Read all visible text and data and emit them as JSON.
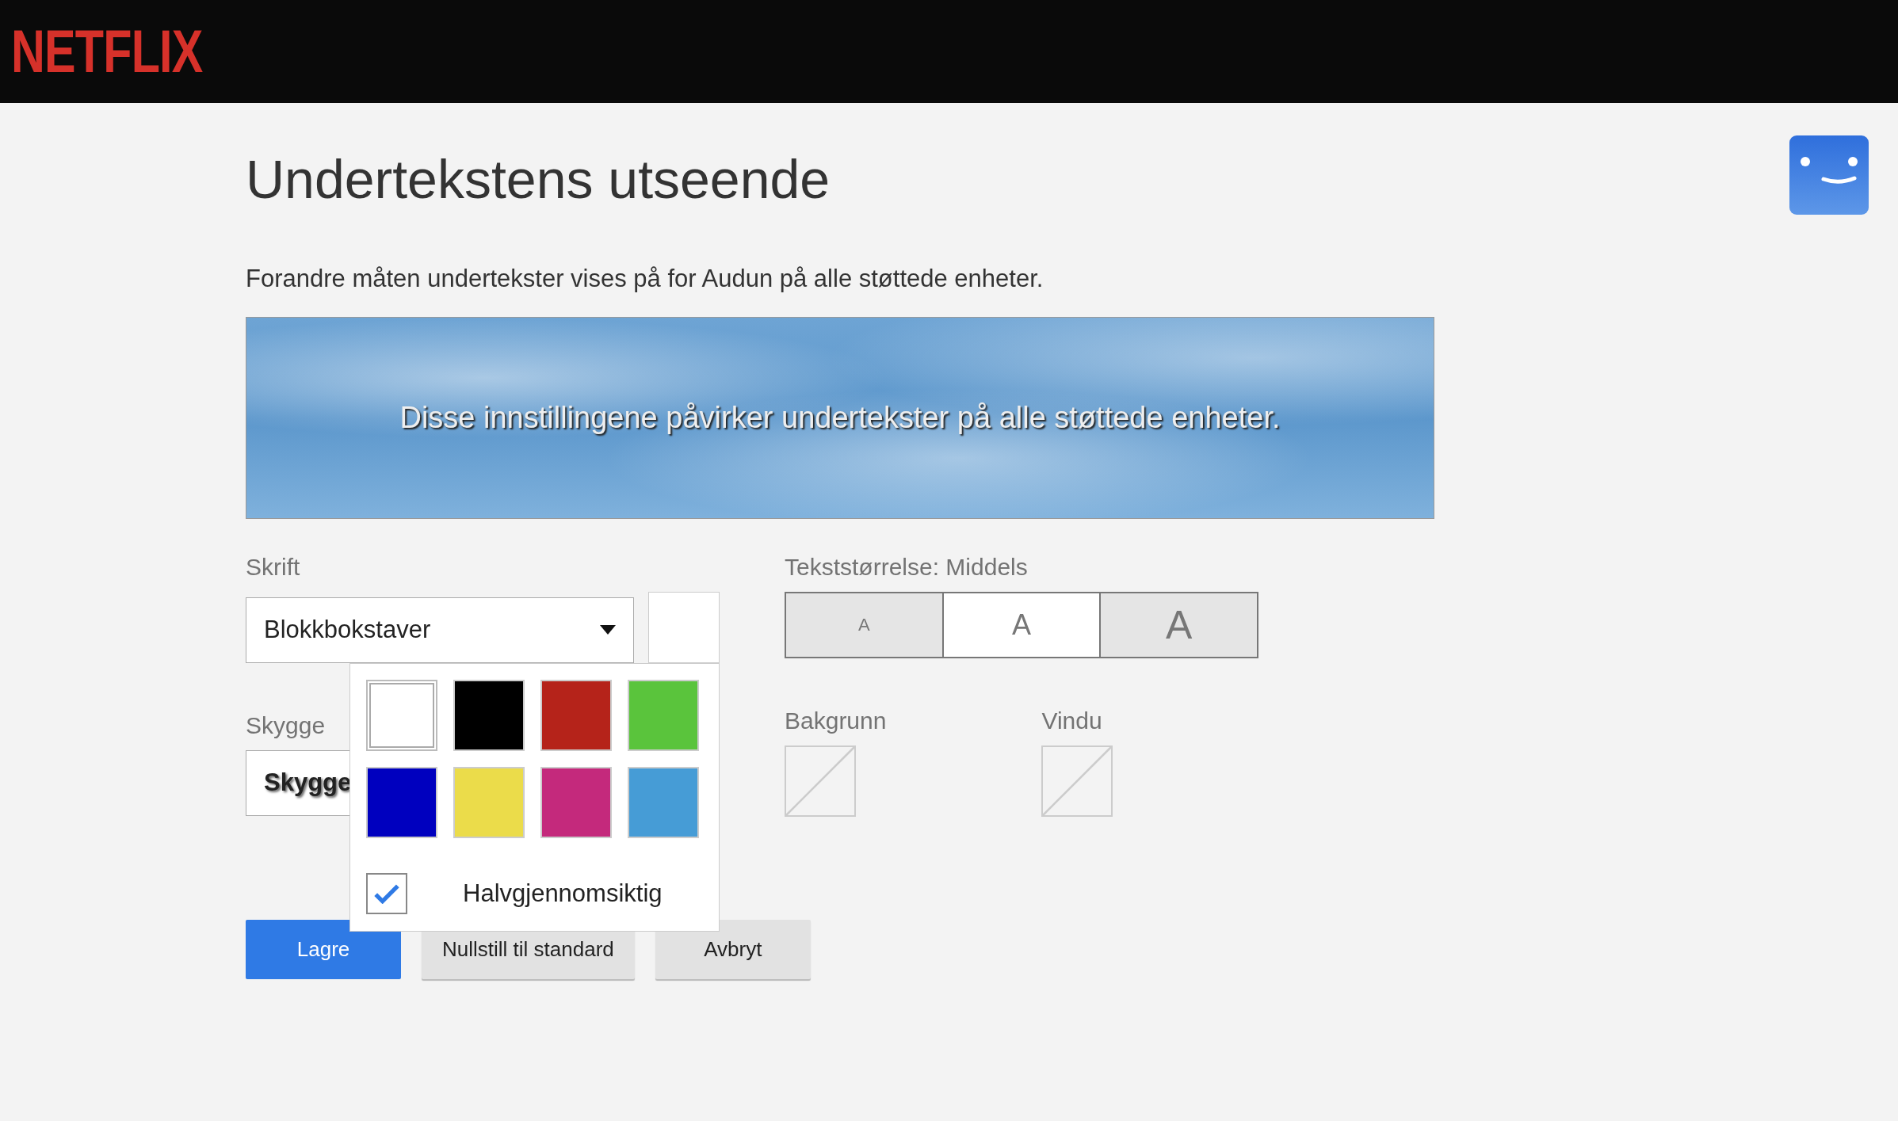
{
  "header": {
    "logo": "NETFLIX"
  },
  "title": "Undertekstens utseende",
  "description": "Forandre måten undertekster vises på for Audun på alle støttede enheter.",
  "preview": {
    "text": "Disse innstillingene påvirker undertekster på alle støttede enheter."
  },
  "font": {
    "label": "Skrift",
    "value": "Blokkbokstaver",
    "swatches": [
      {
        "color": "#ffffff",
        "selected": true
      },
      {
        "color": "#000000",
        "selected": false
      },
      {
        "color": "#b5231a",
        "selected": false
      },
      {
        "color": "#5ac43c",
        "selected": false
      },
      {
        "color": "#0000bf",
        "selected": false
      },
      {
        "color": "#ebdc4a",
        "selected": false
      },
      {
        "color": "#c4297c",
        "selected": false
      },
      {
        "color": "#469cd6",
        "selected": false
      }
    ],
    "semi_transparent": {
      "label": "Halvgjennomsiktig",
      "checked": true
    }
  },
  "text_size": {
    "label": "Tekststørrelse: Middels",
    "options": [
      {
        "label": "A",
        "kind": "small",
        "selected": false
      },
      {
        "label": "A",
        "kind": "medium",
        "selected": true
      },
      {
        "label": "A",
        "kind": "large",
        "selected": false
      }
    ]
  },
  "shadow": {
    "label": "Skygge",
    "value": "Skygge"
  },
  "background": {
    "label": "Bakgrunn"
  },
  "window": {
    "label": "Vindu"
  },
  "buttons": [
    {
      "label": "Lagre",
      "kind": "primary"
    },
    {
      "label": "Nullstill til standard",
      "kind": "secondary"
    },
    {
      "label": "Avbryt",
      "kind": "secondary"
    }
  ]
}
